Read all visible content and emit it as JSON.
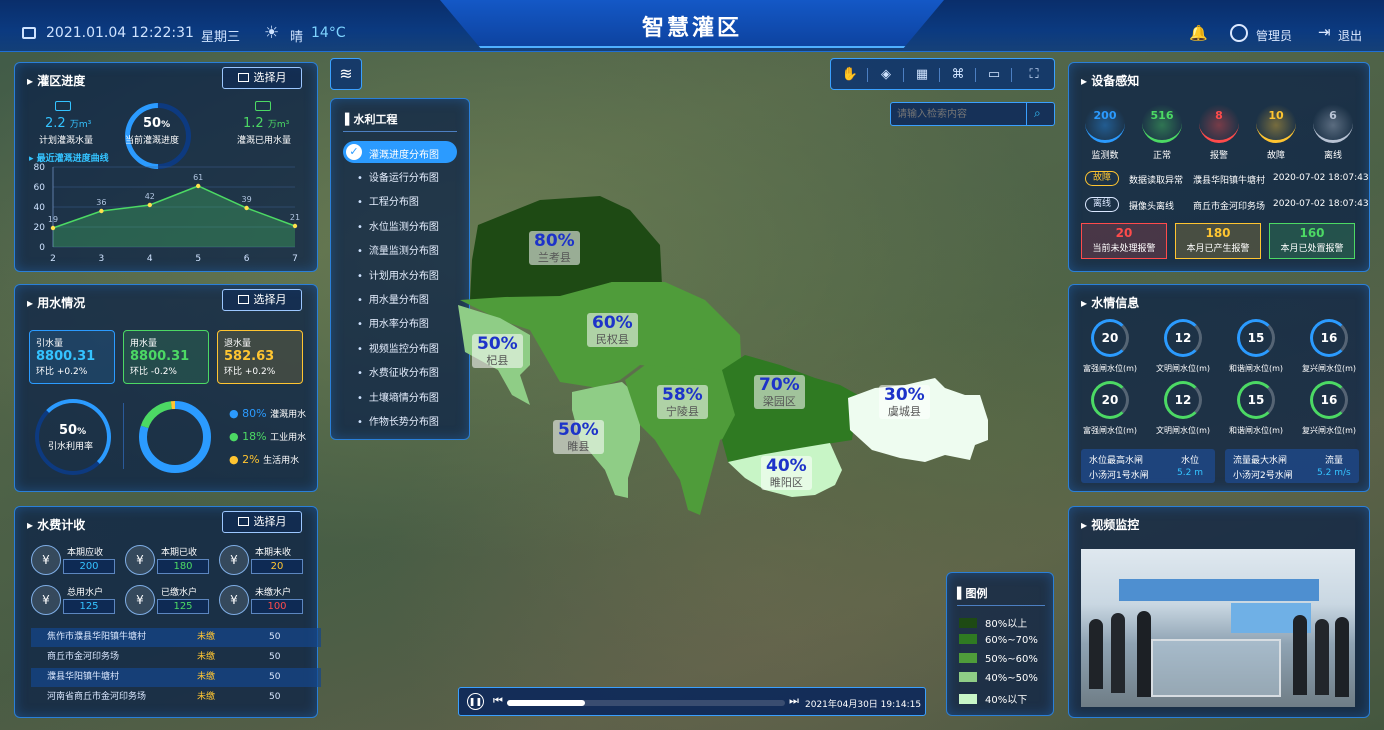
{
  "header": {
    "date": "2021.01.04",
    "time": "12:22:31",
    "weekday": "星期三",
    "weather": "晴",
    "temp": "14°C",
    "title": "智慧灌区",
    "user": "管理员",
    "logout": "退出"
  },
  "irrigation": {
    "title": "灌区进度",
    "month_btn": "选择月",
    "plan": "2.2",
    "plan_unit": "万m³",
    "plan_label": "计划灌溉水量",
    "progress": "50",
    "progress_unit": "%",
    "progress_label": "当前灌溉进度",
    "used": "1.2",
    "used_unit": "万m³",
    "used_label": "灌溉已用水量",
    "curve_title": "最近灌溉进度曲线",
    "chart_data": {
      "type": "area",
      "x": [
        2,
        3,
        4,
        5,
        6,
        7
      ],
      "values": [
        19,
        36,
        42,
        61,
        39,
        21
      ],
      "ylim": [
        0,
        80
      ],
      "yticks": [
        0,
        20,
        40,
        60,
        80
      ]
    }
  },
  "water_use": {
    "title": "用水情况",
    "month_btn": "选择月",
    "intake": {
      "label": "引水量",
      "value": "8800.31",
      "change": "环比 +0.2%"
    },
    "usage": {
      "label": "用水量",
      "value": "8800.31",
      "change": "环比 -0.2%"
    },
    "return": {
      "label": "退水量",
      "value": "582.63",
      "change": "环比 +0.2%"
    },
    "rate": "50",
    "rate_unit": "%",
    "rate_label": "引水利用率",
    "donut": [
      {
        "pct": "80%",
        "label": "灌溉用水",
        "color": "#2b9bff",
        "value": 80
      },
      {
        "pct": "18%",
        "label": "工业用水",
        "color": "#4cd964",
        "value": 18
      },
      {
        "pct": "2%",
        "label": "生活用水",
        "color": "#ffc531",
        "value": 2
      }
    ]
  },
  "fees": {
    "title": "水费计收",
    "month_btn": "选择月",
    "items": [
      {
        "label": "本期应收",
        "value": "200"
      },
      {
        "label": "本期已收",
        "value": "180"
      },
      {
        "label": "本期未收",
        "value": "20"
      },
      {
        "label": "总用水户",
        "value": "125"
      },
      {
        "label": "已缴水户",
        "value": "125"
      },
      {
        "label": "未缴水户",
        "value": "100"
      }
    ],
    "rows": [
      {
        "name": "焦作市濮县华阳镇牛塘村",
        "status": "未缴",
        "amount": "50"
      },
      {
        "name": "商丘市金河印务场",
        "status": "未缴",
        "amount": "50"
      },
      {
        "name": "濮县华阳镇牛塘村",
        "status": "未缴",
        "amount": "50"
      },
      {
        "name": "河南省商丘市金河印务场",
        "status": "未缴",
        "amount": "50"
      }
    ]
  },
  "layers": {
    "title": "水利工程",
    "active": "灌溉进度分布图",
    "items": [
      "设备运行分布图",
      "工程分布图",
      "水位监测分布图",
      "流量监测分布图",
      "计划用水分布图",
      "用水量分布图",
      "用水率分布图",
      "视频监控分布图",
      "水费征收分布图",
      "土壤墒情分布图",
      "作物长势分布图"
    ]
  },
  "search": {
    "placeholder": "请输入检索内容"
  },
  "regions": [
    {
      "name": "兰考县",
      "pct": "80%"
    },
    {
      "name": "民权县",
      "pct": "60%"
    },
    {
      "name": "杞县",
      "pct": "50%"
    },
    {
      "name": "宁陵县",
      "pct": "58%"
    },
    {
      "name": "梁园区",
      "pct": "70%"
    },
    {
      "name": "虞城县",
      "pct": "30%"
    },
    {
      "name": "睢县",
      "pct": "50%"
    },
    {
      "name": "睢阳区",
      "pct": "40%"
    }
  ],
  "legend": {
    "title": "图例",
    "items": [
      {
        "label": "80%以上",
        "color": "#1e4a14"
      },
      {
        "label": "60%~70%",
        "color": "#2f7a22"
      },
      {
        "label": "50%~60%",
        "color": "#4f9c3a"
      },
      {
        "label": "40%~50%",
        "color": "#8fcd86"
      },
      {
        "label": "40%以下",
        "color": "#c8f5c6"
      }
    ]
  },
  "playback": {
    "datetime": "2021年04月30日 19:14:15",
    "progress": 0.28
  },
  "devices": {
    "title": "设备感知",
    "stats": [
      {
        "value": "200",
        "label": "监测数",
        "color": "#2b9bff"
      },
      {
        "value": "516",
        "label": "正常",
        "color": "#4cd964"
      },
      {
        "value": "8",
        "label": "报警",
        "color": "#ff4b4b"
      },
      {
        "value": "10",
        "label": "故障",
        "color": "#ffc531"
      },
      {
        "value": "6",
        "label": "离线",
        "color": "#b8c3d4"
      }
    ],
    "events": [
      {
        "tag": "故障",
        "desc": "数据读取异常",
        "place": "濮县华阳镇牛塘村",
        "time": "2020-07-02 18:07:43"
      },
      {
        "tag": "离线",
        "desc": "摄像头离线",
        "place": "商丘市金河印务场",
        "time": "2020-07-02 18:07:43"
      }
    ],
    "alerts": [
      {
        "value": "20",
        "label": "当前未处理报警"
      },
      {
        "value": "180",
        "label": "本月已产生报警"
      },
      {
        "value": "160",
        "label": "本月已处置报警"
      }
    ]
  },
  "water_info": {
    "title": "水情信息",
    "row1": [
      {
        "value": "20",
        "label": "富强闸水位(m)"
      },
      {
        "value": "12",
        "label": "文明闸水位(m)"
      },
      {
        "value": "15",
        "label": "和谐闸水位(m)"
      },
      {
        "value": "16",
        "label": "复兴闸水位(m)"
      }
    ],
    "row2": [
      {
        "value": "20",
        "label": "富强闸水位(m)"
      },
      {
        "value": "12",
        "label": "文明闸水位(m)"
      },
      {
        "value": "15",
        "label": "和谐闸水位(m)"
      },
      {
        "value": "16",
        "label": "复兴闸水位(m)"
      }
    ],
    "max_level": {
      "title": "水位最高水闸",
      "gate": "小汤河1号水闸",
      "key": "水位",
      "value": "5.2",
      "unit": "m"
    },
    "max_flow": {
      "title": "流量最大水闸",
      "gate": "小汤河2号水闸",
      "key": "流量",
      "value": "5.2",
      "unit": "m/s"
    }
  },
  "video": {
    "title": "视频监控"
  }
}
